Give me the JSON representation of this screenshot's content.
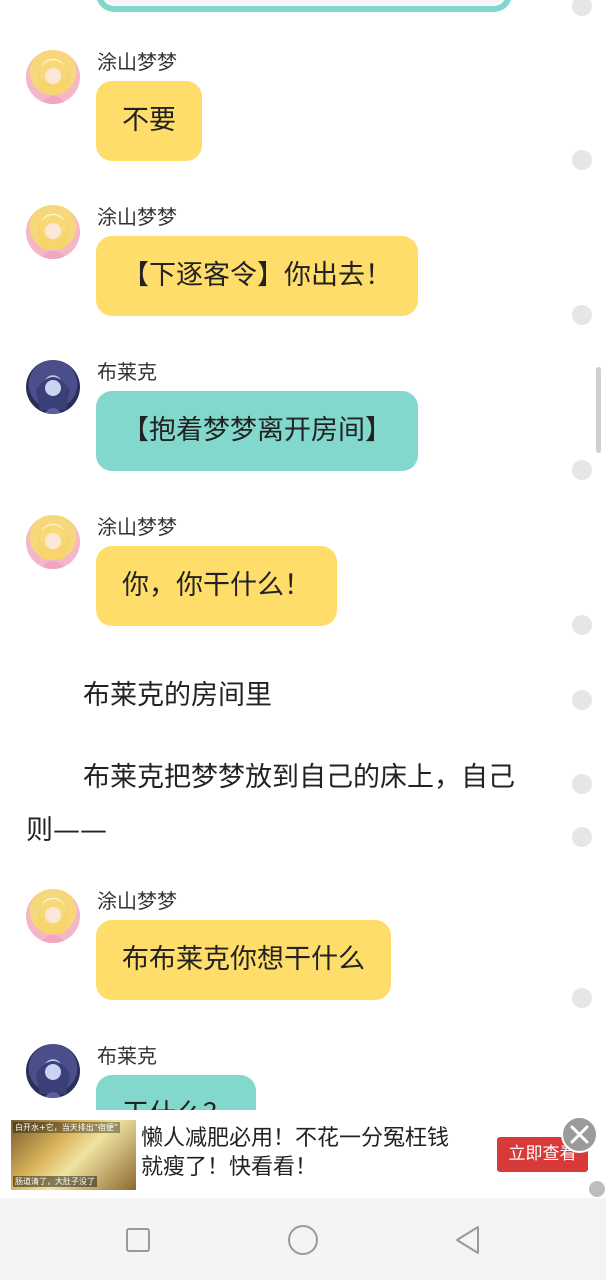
{
  "messages": [
    {
      "speaker": "涂山梦梦",
      "text": "不要"
    },
    {
      "speaker": "涂山梦梦",
      "text": "【下逐客令】你出去！"
    },
    {
      "speaker": "布莱克",
      "text": "【抱着梦梦离开房间】"
    },
    {
      "speaker": "涂山梦梦",
      "text": "你，你干什么！"
    },
    {
      "speaker": "涂山梦梦",
      "text": "布布莱克你想干什么"
    },
    {
      "speaker": "布莱克",
      "text": "干什么？"
    }
  ],
  "narration": {
    "line1": "布莱克的房间里",
    "line2a": "布莱克把梦梦放到自己的床上，自己",
    "line2b": "则——"
  },
  "ad": {
    "thumb_caption_top": "白开水+它，当天排出“宿便”",
    "thumb_caption_bottom": "肠道清了，大肚子没了",
    "line1": "懒人减肥必用！不花一分冤枉钱",
    "line2": "就瘦了！快看看！",
    "cta": "立即查看"
  },
  "colors": {
    "yellow_bubble": "#ffdd6a",
    "teal_bubble": "#82d8cc",
    "cta_red": "#d83a3a"
  }
}
